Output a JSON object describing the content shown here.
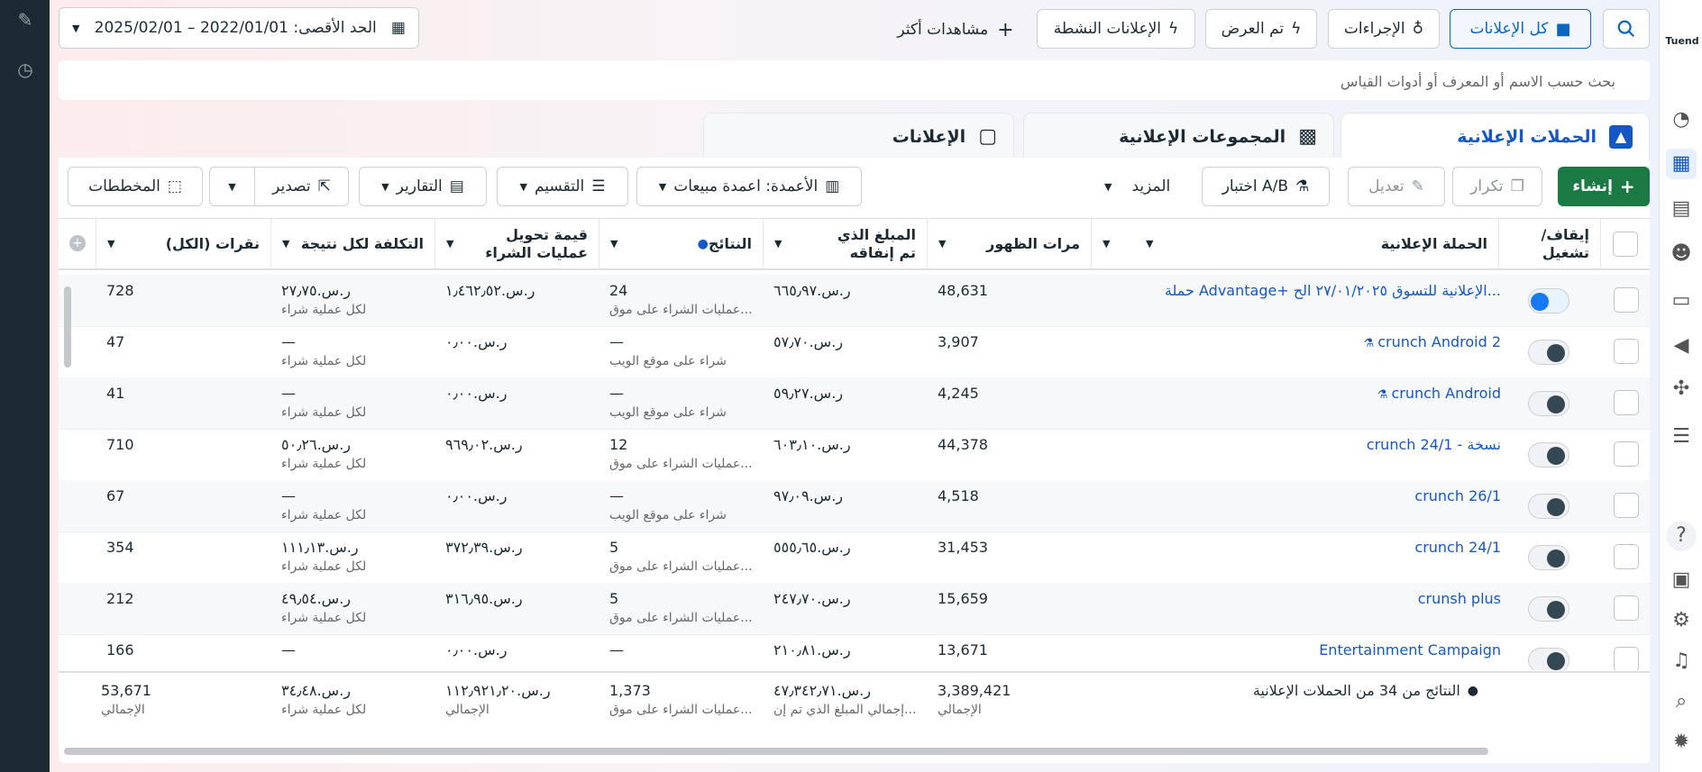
{
  "brand": {
    "logo_text": "Tuend",
    "accent": "#0a66c2",
    "green": "#1b7a43"
  },
  "topbar": {
    "search_icon": "search-icon",
    "all_ads": "كل الإعلانات",
    "actions": "الإجراءات",
    "shown": "تم العرض",
    "active_ads": "الإعلانات النشطة",
    "more_views": "مشاهدات أكثر",
    "date_range": "الحد الأقصى: 2022/01/01 – 2025/02/01"
  },
  "search": {
    "placeholder": "بحث حسب الاسم أو المعرف أو أدوات القياس"
  },
  "tabs": {
    "campaigns": "الحملات الإعلانية",
    "ad_sets": "المجموعات الإعلانية",
    "ads": "الإعلانات"
  },
  "toolbar": {
    "create": "إنشاء",
    "duplicate": "تكرار",
    "edit": "تعديل",
    "ab_test": "اختبار A/B",
    "more": "المزيد",
    "columns": "الأعمدة: اعمدة مبيعات",
    "breakdown": "التقسيم",
    "reports": "التقارير",
    "export": "تصدير",
    "charts": "المخططات"
  },
  "columns": {
    "toggle": "إيقاف/ تشغيل",
    "campaign": "الحملة الإعلانية",
    "impressions": "مرات الظهور",
    "spent": "المبلغ الذي تم إنفاقه",
    "results": "النتائج",
    "purchase_value": "قيمة تحويل عمليات الشراء",
    "cost_per_result": "التكلفة لكل نتيجة",
    "clicks": "نقرات (الكل)"
  },
  "rows": [
    {
      "on": true,
      "name": "حملة Advantage+ الإعلانية للتسوق ٢٧/٠١/٢٠٢٥ الح...",
      "lab": false,
      "impressions": "48,631",
      "spent": "ر.س.٦٦٥٫٩٧",
      "results": "24",
      "results_sub": "عمليات الشراء على موق...",
      "purchase_value": "ر.س.١٫٤٦٢٫٥٢",
      "cpr": "ر.س.٢٧٫٧٥",
      "cpr_sub": "لكل عملية شراء",
      "clicks": "728"
    },
    {
      "on": false,
      "name": "crunch Android 2",
      "lab": true,
      "impressions": "3,907",
      "spent": "ر.س.٥٧٫٧٠",
      "results": "—",
      "results_sub": "شراء على موقع الويب",
      "purchase_value": "ر.س.٠٫٠٠",
      "cpr": "—",
      "cpr_sub": "لكل عملية شراء",
      "clicks": "47"
    },
    {
      "on": false,
      "name": "crunch Android",
      "lab": true,
      "impressions": "4,245",
      "spent": "ر.س.٥٩٫٢٧",
      "results": "—",
      "results_sub": "شراء على موقع الويب",
      "purchase_value": "ر.س.٠٫٠٠",
      "cpr": "—",
      "cpr_sub": "لكل عملية شراء",
      "clicks": "41"
    },
    {
      "on": false,
      "name": "crunch 24/1 - نسخة",
      "lab": false,
      "impressions": "44,378",
      "spent": "ر.س.٦٠٣٫١٠",
      "results": "12",
      "results_sub": "عمليات الشراء على موق...",
      "purchase_value": "ر.س.٩٦٩٫٠٢",
      "cpr": "ر.س.٥٠٫٢٦",
      "cpr_sub": "لكل عملية شراء",
      "clicks": "710"
    },
    {
      "on": false,
      "name": "crunch 26/1",
      "lab": false,
      "impressions": "4,518",
      "spent": "ر.س.٩٧٫٠٩",
      "results": "—",
      "results_sub": "شراء على موقع الويب",
      "purchase_value": "ر.س.٠٫٠٠",
      "cpr": "—",
      "cpr_sub": "لكل عملية شراء",
      "clicks": "67"
    },
    {
      "on": false,
      "name": "crunch 24/1",
      "lab": false,
      "impressions": "31,453",
      "spent": "ر.س.٥٥٥٫٦٥",
      "results": "5",
      "results_sub": "عمليات الشراء على موق...",
      "purchase_value": "ر.س.٣٧٢٫٣٩",
      "cpr": "ر.س.١١١٫١٣",
      "cpr_sub": "لكل عملية شراء",
      "clicks": "354"
    },
    {
      "on": false,
      "name": "crunsh plus",
      "lab": false,
      "impressions": "15,659",
      "spent": "ر.س.٢٤٧٫٧٠",
      "results": "5",
      "results_sub": "عمليات الشراء على موق...",
      "purchase_value": "ر.س.٣١٦٫٩٥",
      "cpr": "ر.س.٤٩٫٥٤",
      "cpr_sub": "لكل عملية شراء",
      "clicks": "212"
    },
    {
      "on": false,
      "name": "Entertainment Campaign",
      "lab": false,
      "impressions": "13,671",
      "spent": "ر.س.٢١٠٫٨١",
      "results": "—",
      "results_sub": "",
      "purchase_value": "ر.س.٠٫٠٠",
      "cpr": "—",
      "cpr_sub": "",
      "clicks": "166"
    }
  ],
  "footer": {
    "label": "النتائج من 34 من الحملات الإعلانية",
    "impressions": "3,389,421",
    "impressions_sub": "الإجمالي",
    "spent": "ر.س.٤٧٫٣٤٢٫٧١",
    "spent_sub": "إجمالي المبلغ الذي تم إن...",
    "results": "1,373",
    "results_sub": "عمليات الشراء على موق...",
    "purchase_value": "ر.س.١١٢٫٩٢١٫٢٠",
    "purchase_value_sub": "الإجمالي",
    "cpr": "ر.س.٣٤٫٤٨",
    "cpr_sub": "لكل عملية شراء",
    "clicks": "53,671",
    "clicks_sub": "الإجمالي"
  }
}
